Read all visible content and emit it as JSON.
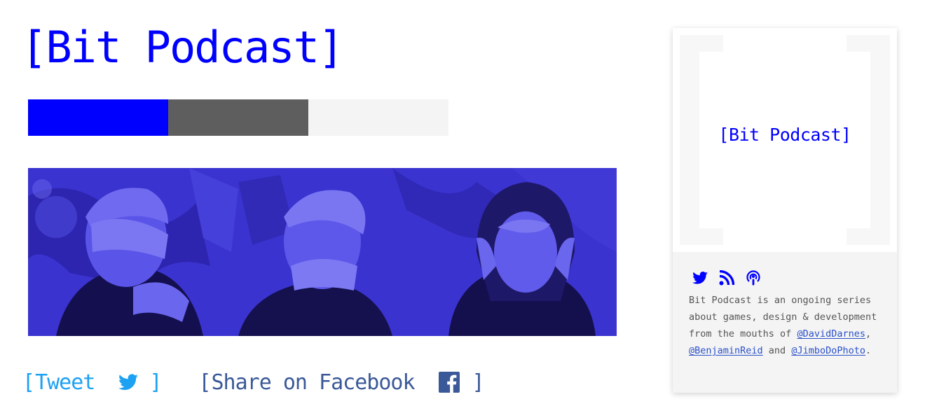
{
  "header": {
    "title": "[Bit Podcast]"
  },
  "palette": {
    "swatches": [
      "#0000ff",
      "#5e5e5e",
      "#f4f4f4"
    ]
  },
  "hero": {
    "tint": "#2e27c9"
  },
  "share": {
    "tweet": {
      "open": "[",
      "label": "Tweet",
      "icon": "twitter-icon",
      "close": "]",
      "color": "#1da1f2"
    },
    "facebook": {
      "open": "[",
      "label": "Share on Facebook",
      "icon": "facebook-icon",
      "close": "]",
      "color": "#3b5998"
    }
  },
  "sidebar": {
    "logo_text": "[Bit Podcast]",
    "icons": [
      "twitter-icon",
      "rss-icon",
      "podcast-icon"
    ],
    "icon_color": "#0000ff",
    "description": {
      "text_before": "Bit Podcast is an ongoing series about games, design & development from the mouths of ",
      "link1": "@DavidDarnes",
      "sep1": ", ",
      "link2": "@BenjaminReid",
      "sep2": " and ",
      "link3": "@JimboDoPhoto",
      "end": "."
    }
  }
}
